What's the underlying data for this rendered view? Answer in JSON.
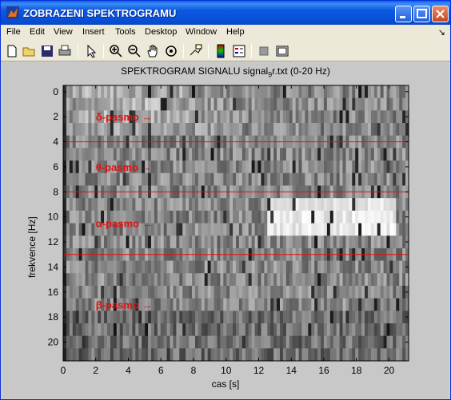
{
  "window": {
    "title": "ZOBRAZENI SPEKTROGRAMU",
    "buttons": [
      "minimize",
      "maximize",
      "close"
    ]
  },
  "menu": {
    "items": [
      "File",
      "Edit",
      "View",
      "Insert",
      "Tools",
      "Desktop",
      "Window",
      "Help"
    ],
    "dock_glyph": "↘"
  },
  "toolbar": {
    "icons": [
      "new-file-icon",
      "open-folder-icon",
      "save-icon",
      "print-icon",
      "pointer-icon",
      "zoom-in-icon",
      "zoom-out-icon",
      "pan-hand-icon",
      "rotate-3d-icon",
      "data-cursor-icon",
      "colorbar-icon",
      "legend-icon",
      "hide-plot-tools-icon",
      "show-plot-tools-icon"
    ]
  },
  "plot": {
    "title_main": "SPEKTROGRAM SIGNALU signal",
    "title_sub": "9",
    "title_rest": "r.txt (0-20 Hz)",
    "xlabel": "cas [s]",
    "ylabel": "frekvence [Hz]"
  },
  "chart_data": {
    "type": "heatmap",
    "title": "SPEKTROGRAM SIGNALU signal9r.txt (0-20 Hz)",
    "xlabel": "cas [s]",
    "ylabel": "frekvence [Hz]",
    "xlim": [
      0,
      21.2
    ],
    "ylim": [
      21.5,
      -0.5
    ],
    "x_ticks": [
      0,
      2,
      4,
      6,
      8,
      10,
      12,
      14,
      16,
      18,
      20
    ],
    "y_ticks": [
      0,
      2,
      4,
      6,
      8,
      10,
      12,
      14,
      16,
      18,
      20
    ],
    "colormap": "gray",
    "band_lines_hz": [
      4,
      8,
      13
    ],
    "band_line_color": "#E01010",
    "bands": [
      {
        "label": "δ-pasmo →",
        "x": 2,
        "y": 2
      },
      {
        "label": "θ-pasmo →",
        "x": 2,
        "y": 6
      },
      {
        "label": "α-pasmo →",
        "x": 2,
        "y": 10.5
      },
      {
        "label": "β-pasmo →",
        "x": 2,
        "y": 17
      }
    ],
    "highlights": [
      {
        "region": "alpha",
        "x_range": [
          12.5,
          20.5
        ],
        "y_range": [
          9,
          11.5
        ],
        "intensity": "high"
      },
      {
        "region": "delta",
        "x_range": [
          0.5,
          10
        ],
        "y_range": [
          0,
          3
        ],
        "intensity": "medium"
      }
    ]
  }
}
